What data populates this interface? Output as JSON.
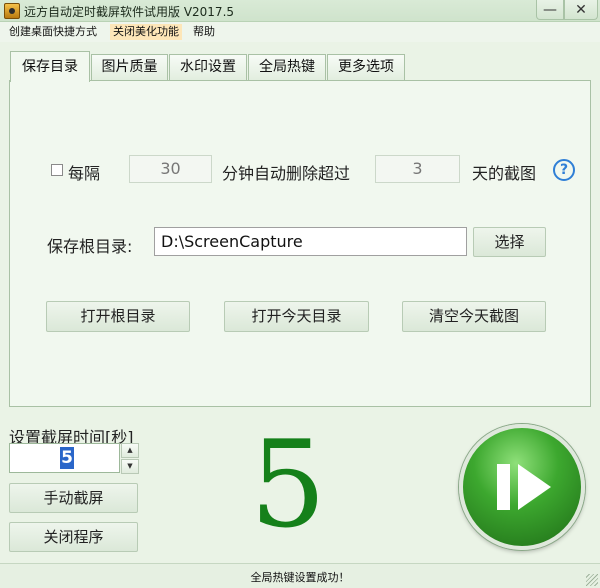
{
  "window": {
    "title": "远方自动定时截屏软件试用版 V2017.5",
    "minimize_symbol": "—",
    "close_symbol": "✕"
  },
  "menu": {
    "items": [
      "创建桌面快捷方式",
      "关闭美化功能",
      "帮助"
    ]
  },
  "tabs": [
    {
      "label": "保存目录",
      "active": true
    },
    {
      "label": "图片质量",
      "active": false
    },
    {
      "label": "水印设置",
      "active": false
    },
    {
      "label": "全局热键",
      "active": false
    },
    {
      "label": "更多选项",
      "active": false
    }
  ],
  "auto_delete": {
    "checked": false,
    "label_every": "每隔",
    "minutes_value": "30",
    "label_minutes": "分钟自动删除超过",
    "days_value": "3",
    "label_days": "天的截图",
    "help_symbol": "?"
  },
  "save_root": {
    "label": "保存根目录:",
    "path": "D:\\ScreenCapture",
    "choose_label": "选择"
  },
  "actions": {
    "open_root": "打开根目录",
    "open_today": "打开今天目录",
    "clear_today": "清空今天截图"
  },
  "capture_interval": {
    "label": "设置截屏时间[秒]",
    "value": "5",
    "up_symbol": "▲",
    "down_symbol": "▼"
  },
  "buttons": {
    "manual_capture": "手动截屏",
    "close_program": "关闭程序"
  },
  "countdown": "5",
  "status": "全局热键设置成功！",
  "icons": {
    "play": "play-pause-icon",
    "help": "help-icon"
  },
  "colors": {
    "accent_green": "#15801a",
    "selection_blue": "#2a66c9",
    "help_blue": "#2f7fd6"
  }
}
